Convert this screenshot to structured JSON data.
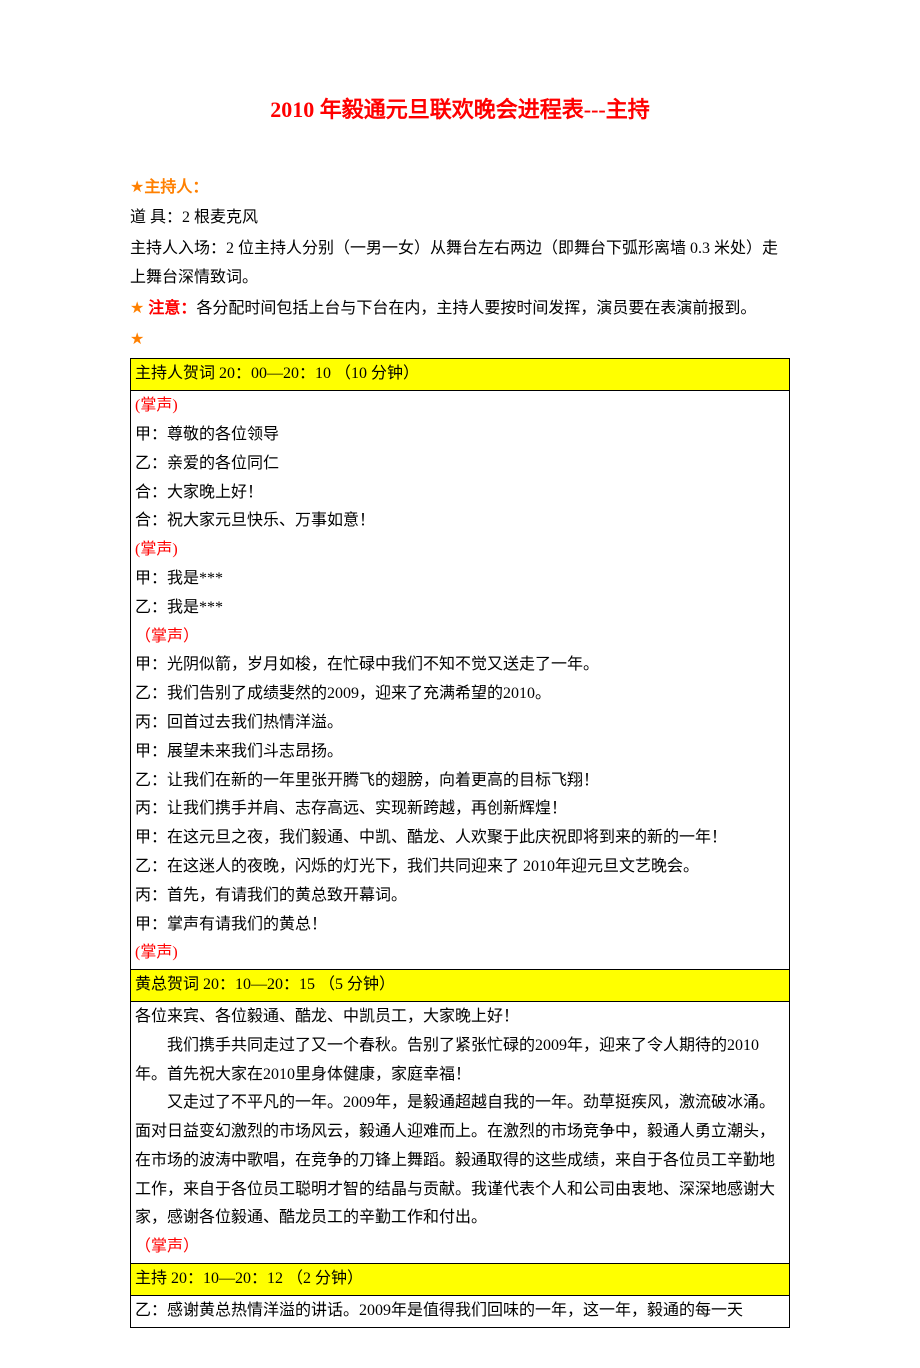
{
  "title": "2010 年毅通元旦联欢晚会进程表---主持",
  "hosts_label": "主持人：",
  "props": "道   具：2 根麦克风",
  "entrance": "主持人入场：2 位主持人分别（一男一女）从舞台左右两边（即舞台下弧形离墙 0.3 米处）走上舞台深情致词。",
  "notice_label": "注意：",
  "notice_text": "各分配时间包括上台与下台在内，主持人要按时间发挥，演员要在表演前报到。",
  "star": "★",
  "section1": {
    "header": "主持人贺词        20：00—20：10 （10 分钟）",
    "lines": [
      "(掌声)",
      "甲：尊敬的各位领导",
      "乙：亲爱的各位同仁",
      "合：大家晚上好！",
      "合：祝大家元旦快乐、万事如意！",
      "(掌声)",
      "甲：我是***",
      "乙：我是***",
      "（掌声）",
      "甲：光阴似箭，岁月如梭，在忙碌中我们不知不觉又送走了一年。",
      "乙：我们告别了成绩斐然的2009，迎来了充满希望的2010。",
      "丙：回首过去我们热情洋溢。",
      "甲：展望未来我们斗志昂扬。",
      "乙：让我们在新的一年里张开腾飞的翅膀，向着更高的目标飞翔！",
      "丙：让我们携手并肩、志存高远、实现新跨越，再创新辉煌！",
      "甲：在这元旦之夜，我们毅通、中凯、酷龙、人欢聚于此庆祝即将到来的新的一年！",
      "乙：在这迷人的夜晚，闪烁的灯光下，我们共同迎来了 2010年迎元旦文艺晚会。",
      "丙：首先，有请我们的黄总致开幕词。",
      "甲：掌声有请我们的黄总！",
      "(掌声)"
    ]
  },
  "section2": {
    "header": "黄总贺词         20：10—20：15 （5 分钟）",
    "p1": "各位来宾、各位毅通、酷龙、中凯员工，大家晚上好！",
    "p2": "我们携手共同走过了又一个春秋。告别了紧张忙碌的2009年，迎来了令人期待的2010年。首先祝大家在2010里身体健康，家庭幸福！",
    "p3": "又走过了不平凡的一年。2009年，是毅通超越自我的一年。劲草挺疾风，激流破冰涌。面对日益变幻激烈的市场风云，毅通人迎难而上。在激烈的市场竞争中，毅通人勇立潮头，在市场的波涛中歌唱，在竞争的刀锋上舞蹈。毅通取得的这些成绩，来自于各位员工辛勤地工作，来自于各位员工聪明才智的结晶与贡献。我谨代表个人和公司由衷地、深深地感谢大家，感谢各位毅通、酷龙员工的辛勤工作和付出。",
    "p4": "（掌声）"
  },
  "section3": {
    "header": "主持         20：10—20：12 （2 分钟）",
    "line": "乙：感谢黄总热情洋溢的讲话。2009年是值得我们回味的一年，这一年，毅通的每一天"
  }
}
